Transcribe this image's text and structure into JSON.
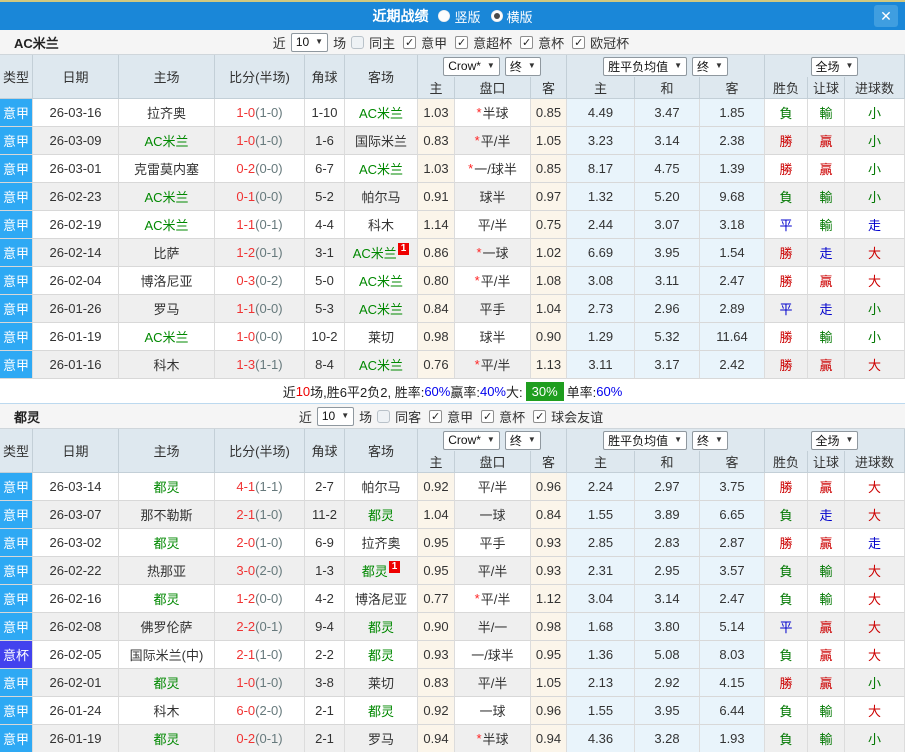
{
  "titlebar": {
    "title": "近期战绩",
    "layout_options": [
      {
        "label": "竖版",
        "selected": false
      },
      {
        "label": "横版",
        "selected": true
      }
    ],
    "close_label": "✕"
  },
  "colors": {
    "titlebar_bg": "#1a87d8",
    "type_league_bg": "#2ea9f4",
    "type_cup_bg": "#4242ee",
    "focal_team": "#008800",
    "score": "#f03333",
    "result_red": "#cc0000",
    "result_blue": "#0000cc",
    "result_green": "#007700",
    "summary_value": "#0000ee",
    "summary_badge_bg": "#1f9e1f"
  },
  "result_color_map": {
    "勝": "red",
    "贏": "red",
    "大": "red",
    "平": "blue",
    "走": "blue",
    "負": "green",
    "輸": "green",
    "小": "green"
  },
  "type_style_map": {
    "意甲": "t-league",
    "意杯": "t-cup"
  },
  "table_header": {
    "main_cols": [
      "类型",
      "日期",
      "主场",
      "比分(半场)",
      "角球",
      "客场"
    ],
    "odds_company": "Crow*",
    "odds_stage": "终",
    "avg_label": "胜平负均值",
    "avg_stage": "终",
    "scope": "全场",
    "odds_sub": [
      "主",
      "盘口",
      "客"
    ],
    "avg_sub": [
      "主",
      "和",
      "客"
    ],
    "result_sub": [
      "胜负",
      "让球",
      "进球数"
    ]
  },
  "sections": [
    {
      "team": "AC米兰",
      "filter": {
        "near": "近",
        "count": "10",
        "matches": "场",
        "same": {
          "label": "同主",
          "checked": false
        },
        "leagues": [
          {
            "label": "意甲",
            "checked": true
          },
          {
            "label": "意超杯",
            "checked": true
          },
          {
            "label": "意杯",
            "checked": true
          },
          {
            "label": "欧冠杯",
            "checked": true
          }
        ]
      },
      "rows": [
        {
          "type": "意甲",
          "date": "26-03-16",
          "home": {
            "name": "拉齐奥",
            "focal": false
          },
          "score": "1-0",
          "half": "(1-0)",
          "corners": "1-10",
          "away": {
            "name": "AC米兰",
            "focal": true
          },
          "odds": [
            "1.03",
            "*半球",
            "0.85"
          ],
          "avg": [
            "4.49",
            "3.47",
            "1.85"
          ],
          "results": [
            "負",
            "輸",
            "小"
          ]
        },
        {
          "type": "意甲",
          "date": "26-03-09",
          "home": {
            "name": "AC米兰",
            "focal": true
          },
          "score": "1-0",
          "half": "(1-0)",
          "corners": "1-6",
          "away": {
            "name": "国际米兰",
            "focal": false
          },
          "odds": [
            "0.83",
            "*平/半",
            "1.05"
          ],
          "avg": [
            "3.23",
            "3.14",
            "2.38"
          ],
          "results": [
            "勝",
            "贏",
            "小"
          ]
        },
        {
          "type": "意甲",
          "date": "26-03-01",
          "home": {
            "name": "克雷莫内塞",
            "focal": false
          },
          "score": "0-2",
          "half": "(0-0)",
          "corners": "6-7",
          "away": {
            "name": "AC米兰",
            "focal": true
          },
          "odds": [
            "1.03",
            "*一/球半",
            "0.85"
          ],
          "avg": [
            "8.17",
            "4.75",
            "1.39"
          ],
          "results": [
            "勝",
            "贏",
            "小"
          ]
        },
        {
          "type": "意甲",
          "date": "26-02-23",
          "home": {
            "name": "AC米兰",
            "focal": true
          },
          "score": "0-1",
          "half": "(0-0)",
          "corners": "5-2",
          "away": {
            "name": "帕尔马",
            "focal": false
          },
          "odds": [
            "0.91",
            "球半",
            "0.97"
          ],
          "avg": [
            "1.32",
            "5.20",
            "9.68"
          ],
          "results": [
            "負",
            "輸",
            "小"
          ]
        },
        {
          "type": "意甲",
          "date": "26-02-19",
          "home": {
            "name": "AC米兰",
            "focal": true
          },
          "score": "1-1",
          "half": "(0-1)",
          "corners": "4-4",
          "away": {
            "name": "科木",
            "focal": false
          },
          "odds": [
            "1.14",
            "平/半",
            "0.75"
          ],
          "avg": [
            "2.44",
            "3.07",
            "3.18"
          ],
          "results": [
            "平",
            "輸",
            "走"
          ]
        },
        {
          "type": "意甲",
          "date": "26-02-14",
          "home": {
            "name": "比萨",
            "focal": false
          },
          "score": "1-2",
          "half": "(0-1)",
          "corners": "3-1",
          "away": {
            "name": "AC米兰",
            "focal": true,
            "badge": "1"
          },
          "odds": [
            "0.86",
            "*一球",
            "1.02"
          ],
          "avg": [
            "6.69",
            "3.95",
            "1.54"
          ],
          "results": [
            "勝",
            "走",
            "大"
          ]
        },
        {
          "type": "意甲",
          "date": "26-02-04",
          "home": {
            "name": "博洛尼亚",
            "focal": false
          },
          "score": "0-3",
          "half": "(0-2)",
          "corners": "5-0",
          "away": {
            "name": "AC米兰",
            "focal": true
          },
          "odds": [
            "0.80",
            "*平/半",
            "1.08"
          ],
          "avg": [
            "3.08",
            "3.11",
            "2.47"
          ],
          "results": [
            "勝",
            "贏",
            "大"
          ]
        },
        {
          "type": "意甲",
          "date": "26-01-26",
          "home": {
            "name": "罗马",
            "focal": false
          },
          "score": "1-1",
          "half": "(0-0)",
          "corners": "5-3",
          "away": {
            "name": "AC米兰",
            "focal": true
          },
          "odds": [
            "0.84",
            "平手",
            "1.04"
          ],
          "avg": [
            "2.73",
            "2.96",
            "2.89"
          ],
          "results": [
            "平",
            "走",
            "小"
          ]
        },
        {
          "type": "意甲",
          "date": "26-01-19",
          "home": {
            "name": "AC米兰",
            "focal": true
          },
          "score": "1-0",
          "half": "(0-0)",
          "corners": "10-2",
          "away": {
            "name": "莱切",
            "focal": false
          },
          "odds": [
            "0.98",
            "球半",
            "0.90"
          ],
          "avg": [
            "1.29",
            "5.32",
            "11.64"
          ],
          "results": [
            "勝",
            "輸",
            "小"
          ]
        },
        {
          "type": "意甲",
          "date": "26-01-16",
          "home": {
            "name": "科木",
            "focal": false
          },
          "score": "1-3",
          "half": "(1-1)",
          "corners": "8-4",
          "away": {
            "name": "AC米兰",
            "focal": true
          },
          "odds": [
            "0.76",
            "*平/半",
            "1.13"
          ],
          "avg": [
            "3.11",
            "3.17",
            "2.42"
          ],
          "results": [
            "勝",
            "贏",
            "大"
          ]
        }
      ],
      "summary": [
        {
          "t": "近",
          "c": "k"
        },
        {
          "t": "10",
          "c": "r"
        },
        {
          "t": "场,胜6平2负2, 胜率:",
          "c": "k"
        },
        {
          "t": "60%",
          "c": "b"
        },
        {
          "t": " 赢率:",
          "c": "k"
        },
        {
          "t": "40%",
          "c": "b"
        },
        {
          "t": " 大: ",
          "c": "k"
        },
        {
          "t": "30%",
          "c": "g"
        },
        {
          "t": " 单率:",
          "c": "k"
        },
        {
          "t": "60%",
          "c": "b"
        }
      ]
    },
    {
      "team": "都灵",
      "filter": {
        "near": "近",
        "count": "10",
        "matches": "场",
        "same": {
          "label": "同客",
          "checked": false
        },
        "leagues": [
          {
            "label": "意甲",
            "checked": true
          },
          {
            "label": "意杯",
            "checked": true
          },
          {
            "label": "球会友谊",
            "checked": true
          }
        ]
      },
      "rows": [
        {
          "type": "意甲",
          "date": "26-03-14",
          "home": {
            "name": "都灵",
            "focal": true
          },
          "score": "4-1",
          "half": "(1-1)",
          "corners": "2-7",
          "away": {
            "name": "帕尔马",
            "focal": false
          },
          "odds": [
            "0.92",
            "平/半",
            "0.96"
          ],
          "avg": [
            "2.24",
            "2.97",
            "3.75"
          ],
          "results": [
            "勝",
            "贏",
            "大"
          ]
        },
        {
          "type": "意甲",
          "date": "26-03-07",
          "home": {
            "name": "那不勒斯",
            "focal": false
          },
          "score": "2-1",
          "half": "(1-0)",
          "corners": "11-2",
          "away": {
            "name": "都灵",
            "focal": true
          },
          "odds": [
            "1.04",
            "一球",
            "0.84"
          ],
          "avg": [
            "1.55",
            "3.89",
            "6.65"
          ],
          "results": [
            "負",
            "走",
            "大"
          ]
        },
        {
          "type": "意甲",
          "date": "26-03-02",
          "home": {
            "name": "都灵",
            "focal": true
          },
          "score": "2-0",
          "half": "(1-0)",
          "corners": "6-9",
          "away": {
            "name": "拉齐奥",
            "focal": false
          },
          "odds": [
            "0.95",
            "平手",
            "0.93"
          ],
          "avg": [
            "2.85",
            "2.83",
            "2.87"
          ],
          "results": [
            "勝",
            "贏",
            "走"
          ]
        },
        {
          "type": "意甲",
          "date": "26-02-22",
          "home": {
            "name": "热那亚",
            "focal": false
          },
          "score": "3-0",
          "half": "(2-0)",
          "corners": "1-3",
          "away": {
            "name": "都灵",
            "focal": true,
            "badge": "1"
          },
          "odds": [
            "0.95",
            "平/半",
            "0.93"
          ],
          "avg": [
            "2.31",
            "2.95",
            "3.57"
          ],
          "results": [
            "負",
            "輸",
            "大"
          ]
        },
        {
          "type": "意甲",
          "date": "26-02-16",
          "home": {
            "name": "都灵",
            "focal": true
          },
          "score": "1-2",
          "half": "(0-0)",
          "corners": "4-2",
          "away": {
            "name": "博洛尼亚",
            "focal": false
          },
          "odds": [
            "0.77",
            "*平/半",
            "1.12"
          ],
          "avg": [
            "3.04",
            "3.14",
            "2.47"
          ],
          "results": [
            "負",
            "輸",
            "大"
          ]
        },
        {
          "type": "意甲",
          "date": "26-02-08",
          "home": {
            "name": "佛罗伦萨",
            "focal": false
          },
          "score": "2-2",
          "half": "(0-1)",
          "corners": "9-4",
          "away": {
            "name": "都灵",
            "focal": true
          },
          "odds": [
            "0.90",
            "半/一",
            "0.98"
          ],
          "avg": [
            "1.68",
            "3.80",
            "5.14"
          ],
          "results": [
            "平",
            "贏",
            "大"
          ]
        },
        {
          "type": "意杯",
          "date": "26-02-05",
          "home": {
            "name": "国际米兰(中)",
            "focal": false
          },
          "score": "2-1",
          "half": "(1-0)",
          "corners": "2-2",
          "away": {
            "name": "都灵",
            "focal": true
          },
          "odds": [
            "0.93",
            "一/球半",
            "0.95"
          ],
          "avg": [
            "1.36",
            "5.08",
            "8.03"
          ],
          "results": [
            "負",
            "贏",
            "大"
          ]
        },
        {
          "type": "意甲",
          "date": "26-02-01",
          "home": {
            "name": "都灵",
            "focal": true
          },
          "score": "1-0",
          "half": "(1-0)",
          "corners": "3-8",
          "away": {
            "name": "莱切",
            "focal": false
          },
          "odds": [
            "0.83",
            "平/半",
            "1.05"
          ],
          "avg": [
            "2.13",
            "2.92",
            "4.15"
          ],
          "results": [
            "勝",
            "贏",
            "小"
          ]
        },
        {
          "type": "意甲",
          "date": "26-01-24",
          "home": {
            "name": "科木",
            "focal": false
          },
          "score": "6-0",
          "half": "(2-0)",
          "corners": "2-1",
          "away": {
            "name": "都灵",
            "focal": true
          },
          "odds": [
            "0.92",
            "一球",
            "0.96"
          ],
          "avg": [
            "1.55",
            "3.95",
            "6.44"
          ],
          "results": [
            "負",
            "輸",
            "大"
          ]
        },
        {
          "type": "意甲",
          "date": "26-01-19",
          "home": {
            "name": "都灵",
            "focal": true
          },
          "score": "0-2",
          "half": "(0-1)",
          "corners": "2-1",
          "away": {
            "name": "罗马",
            "focal": false
          },
          "odds": [
            "0.94",
            "*半球",
            "0.94"
          ],
          "avg": [
            "4.36",
            "3.28",
            "1.93"
          ],
          "results": [
            "負",
            "輸",
            "小"
          ]
        }
      ]
    }
  ]
}
